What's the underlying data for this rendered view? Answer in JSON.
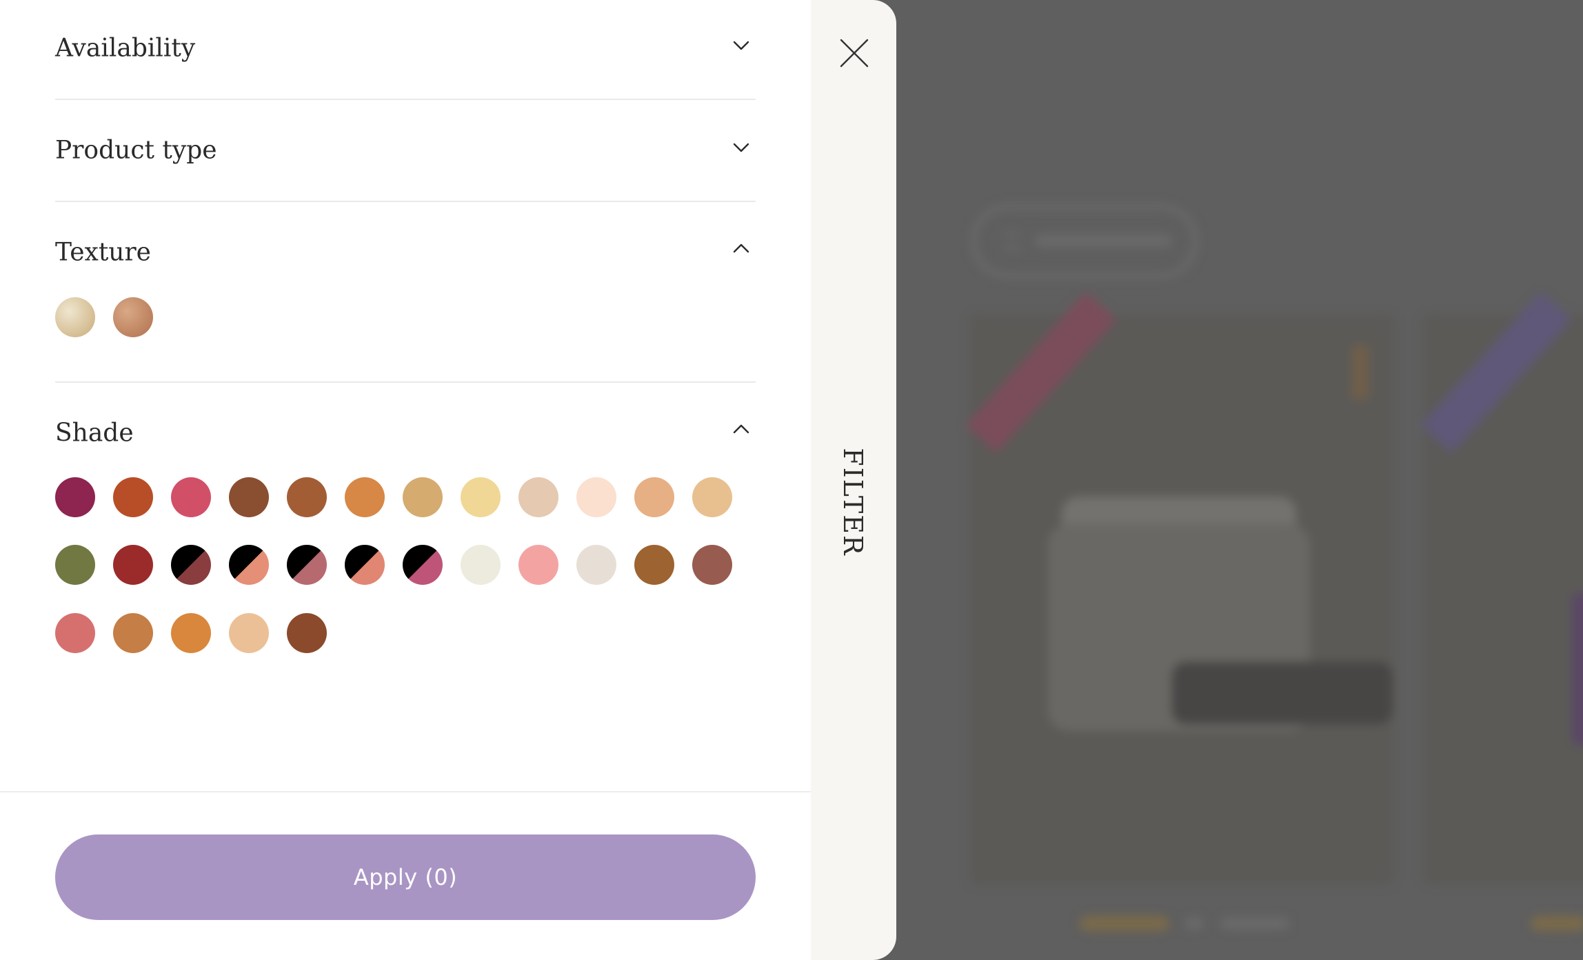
{
  "drawer": {
    "side_label": "FILTER",
    "close_icon": "close-icon",
    "sections": [
      {
        "title": "Availability",
        "expanded": false
      },
      {
        "title": "Product type",
        "expanded": false
      },
      {
        "title": "Texture",
        "expanded": true
      },
      {
        "title": "Shade",
        "expanded": true
      }
    ],
    "textures": [
      {
        "name": "cream-texture",
        "colors": [
          "#efe6cf",
          "#c9ab78"
        ]
      },
      {
        "name": "liquid-texture",
        "colors": [
          "#d9a886",
          "#b0704c"
        ]
      }
    ],
    "shades": [
      [
        "#8e2450",
        "#b84e27",
        "#d24f68",
        "#8a4e30",
        "#a35d35",
        "#d78746",
        "#d5ab6f",
        "#f0d796",
        "#e5c9b0",
        "#fbdfcf",
        "#e7af84",
        "#e8c08f"
      ],
      [
        "#727841",
        "#9b2b2b",
        [
          "#000000",
          "#8a3d3f"
        ],
        [
          "#000000",
          "#e58f76"
        ],
        [
          "#000000",
          "#b66a70"
        ],
        [
          "#000000",
          "#e18672"
        ],
        [
          "#000000",
          "#be5578"
        ],
        "#ecebdd",
        "#f4a3a3",
        "#e7dfd6",
        "#9d6330",
        "#975c4f"
      ],
      [
        "#d6706f",
        "#c57e45",
        "#d9873d",
        "#ecc096",
        "#8a4a2b"
      ]
    ],
    "apply_label": "Apply (0)",
    "accent_color": "#a995c4"
  }
}
